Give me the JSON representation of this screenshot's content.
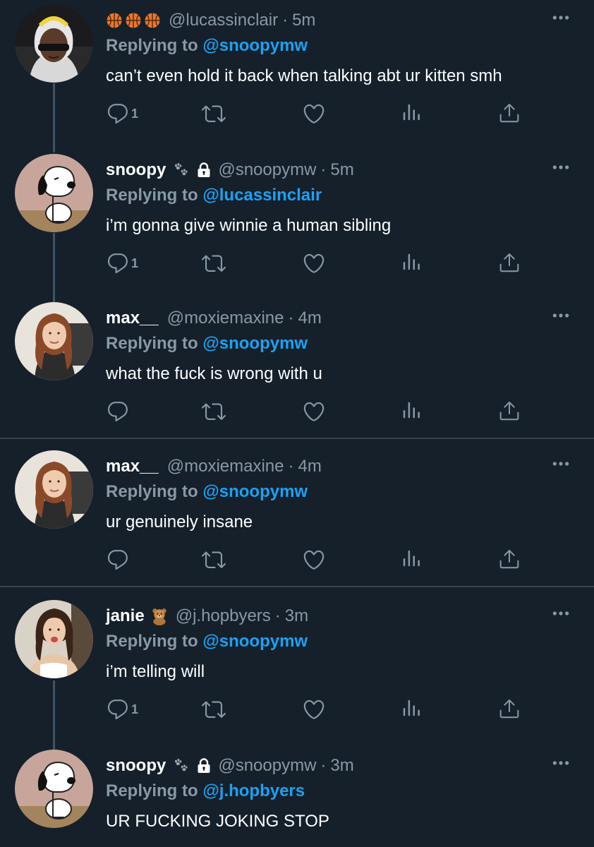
{
  "tweets": [
    {
      "name": "",
      "badges": [
        "basketball",
        "basketball",
        "basketball"
      ],
      "handle": "@lucassinclair",
      "time": "5m",
      "reply_prefix": "Replying to",
      "reply_to": "@snoopymw",
      "text": "can’t even hold it back when talking abt ur kitten smh",
      "reply_count": "1",
      "avatar": "man-in-sunglasses"
    },
    {
      "name": "snoopy",
      "name_icons": [
        "paw-prints",
        "lock"
      ],
      "handle": "@snoopymw",
      "time": "5m",
      "reply_prefix": "Replying to",
      "reply_to": "@lucassinclair",
      "text": "i’m gonna give winnie a human sibling",
      "reply_count": "1",
      "avatar": "snoopy-dog"
    },
    {
      "name": "max__",
      "handle": "@moxiemaxine",
      "time": "4m",
      "reply_prefix": "Replying to",
      "reply_to": "@snoopymw",
      "text": "what the fuck is wrong with u",
      "reply_count": "",
      "avatar": "red-haired-woman"
    },
    {
      "name": "max__",
      "handle": "@moxiemaxine",
      "time": "4m",
      "reply_prefix": "Replying to",
      "reply_to": "@snoopymw",
      "text": "ur genuinely insane",
      "reply_count": "",
      "avatar": "red-haired-woman"
    },
    {
      "name": "janie",
      "name_icons": [
        "teddy-bear"
      ],
      "handle": "@j.hopbyers",
      "time": "3m",
      "reply_prefix": "Replying to",
      "reply_to": "@snoopymw",
      "text": "i’m telling will",
      "reply_count": "1",
      "avatar": "brunette-woman"
    },
    {
      "name": "snoopy",
      "name_icons": [
        "paw-prints",
        "lock"
      ],
      "handle": "@snoopymw",
      "time": "3m",
      "reply_prefix": "Replying to",
      "reply_to": "@j.hopbyers",
      "text": "UR FUCKING JOKING STOP",
      "reply_count": "",
      "avatar": "snoopy-dog"
    }
  ],
  "separator": "·",
  "colors": {
    "background": "#15202b",
    "text": "#ffffff",
    "muted": "#8899a6",
    "link": "#1da1f2",
    "divider": "#38444d",
    "thread_line": "#3d5466"
  }
}
